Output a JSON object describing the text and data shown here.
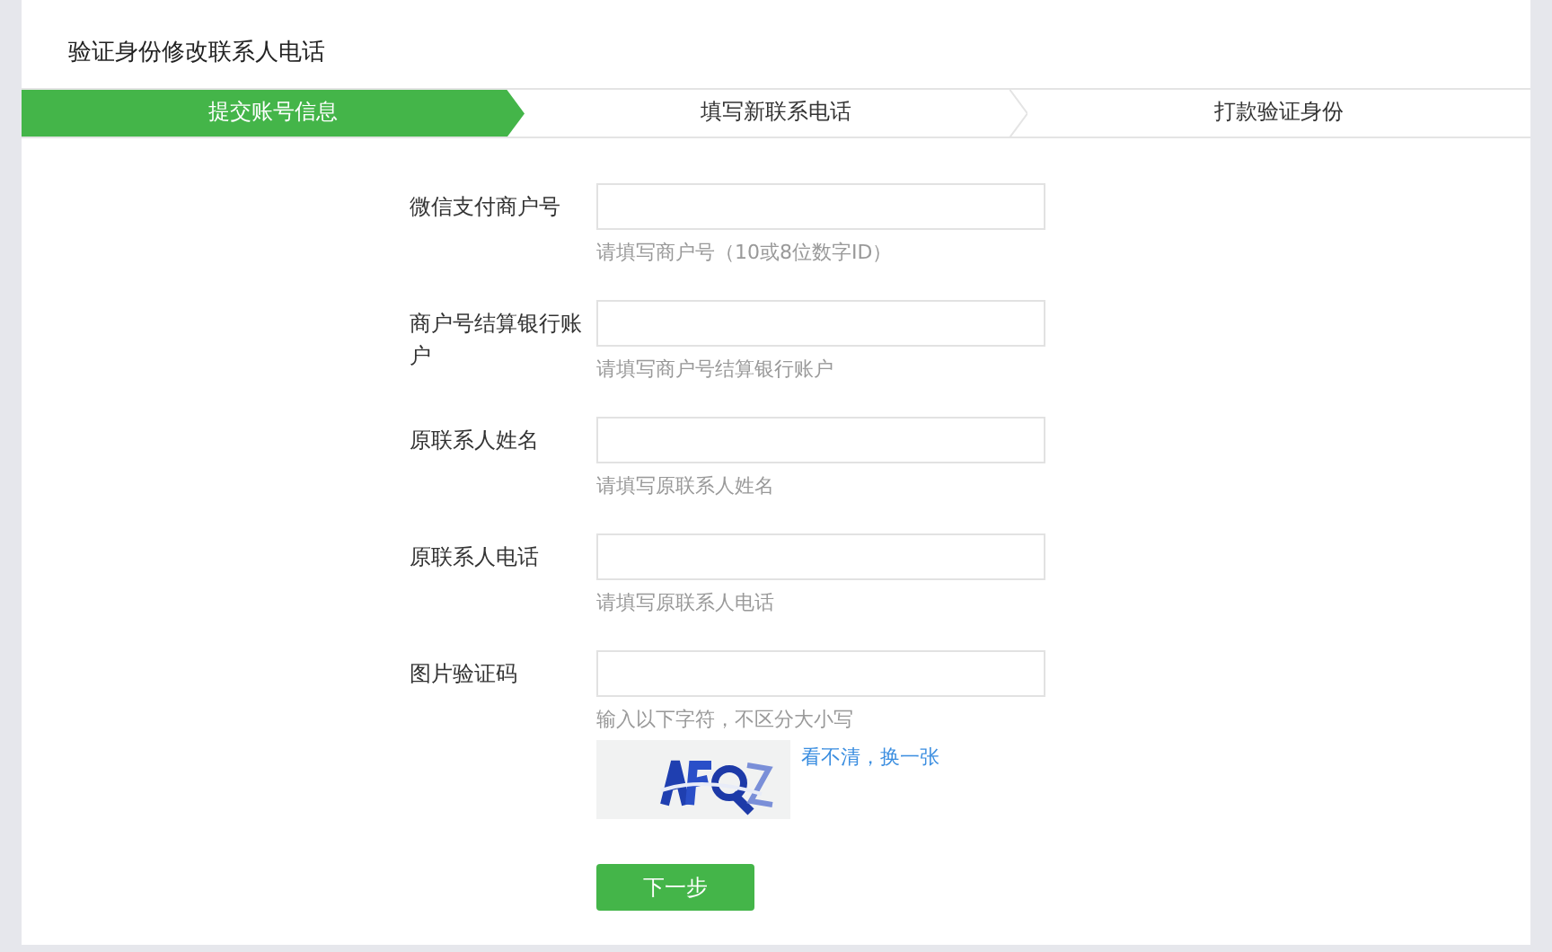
{
  "page": {
    "title": "验证身份修改联系人电话"
  },
  "steps": [
    {
      "label": "提交账号信息",
      "selected": true
    },
    {
      "label": "填写新联系电话",
      "selected": false
    },
    {
      "label": "打款验证身份",
      "selected": false
    }
  ],
  "form": {
    "fields": [
      {
        "label": "微信支付商户号",
        "hint": "请填写商户号（10或8位数字ID）"
      },
      {
        "label": "商户号结算银行账户",
        "hint": "请填写商户号结算银行账户"
      },
      {
        "label": "原联系人姓名",
        "hint": "请填写原联系人姓名"
      },
      {
        "label": "原联系人电话",
        "hint": "请填写原联系人电话"
      },
      {
        "label": "图片验证码",
        "hint": "输入以下字符，不区分大小写",
        "kind": "captcha",
        "refresh_link": "看不清，换一张"
      }
    ],
    "submit": "下一步"
  }
}
